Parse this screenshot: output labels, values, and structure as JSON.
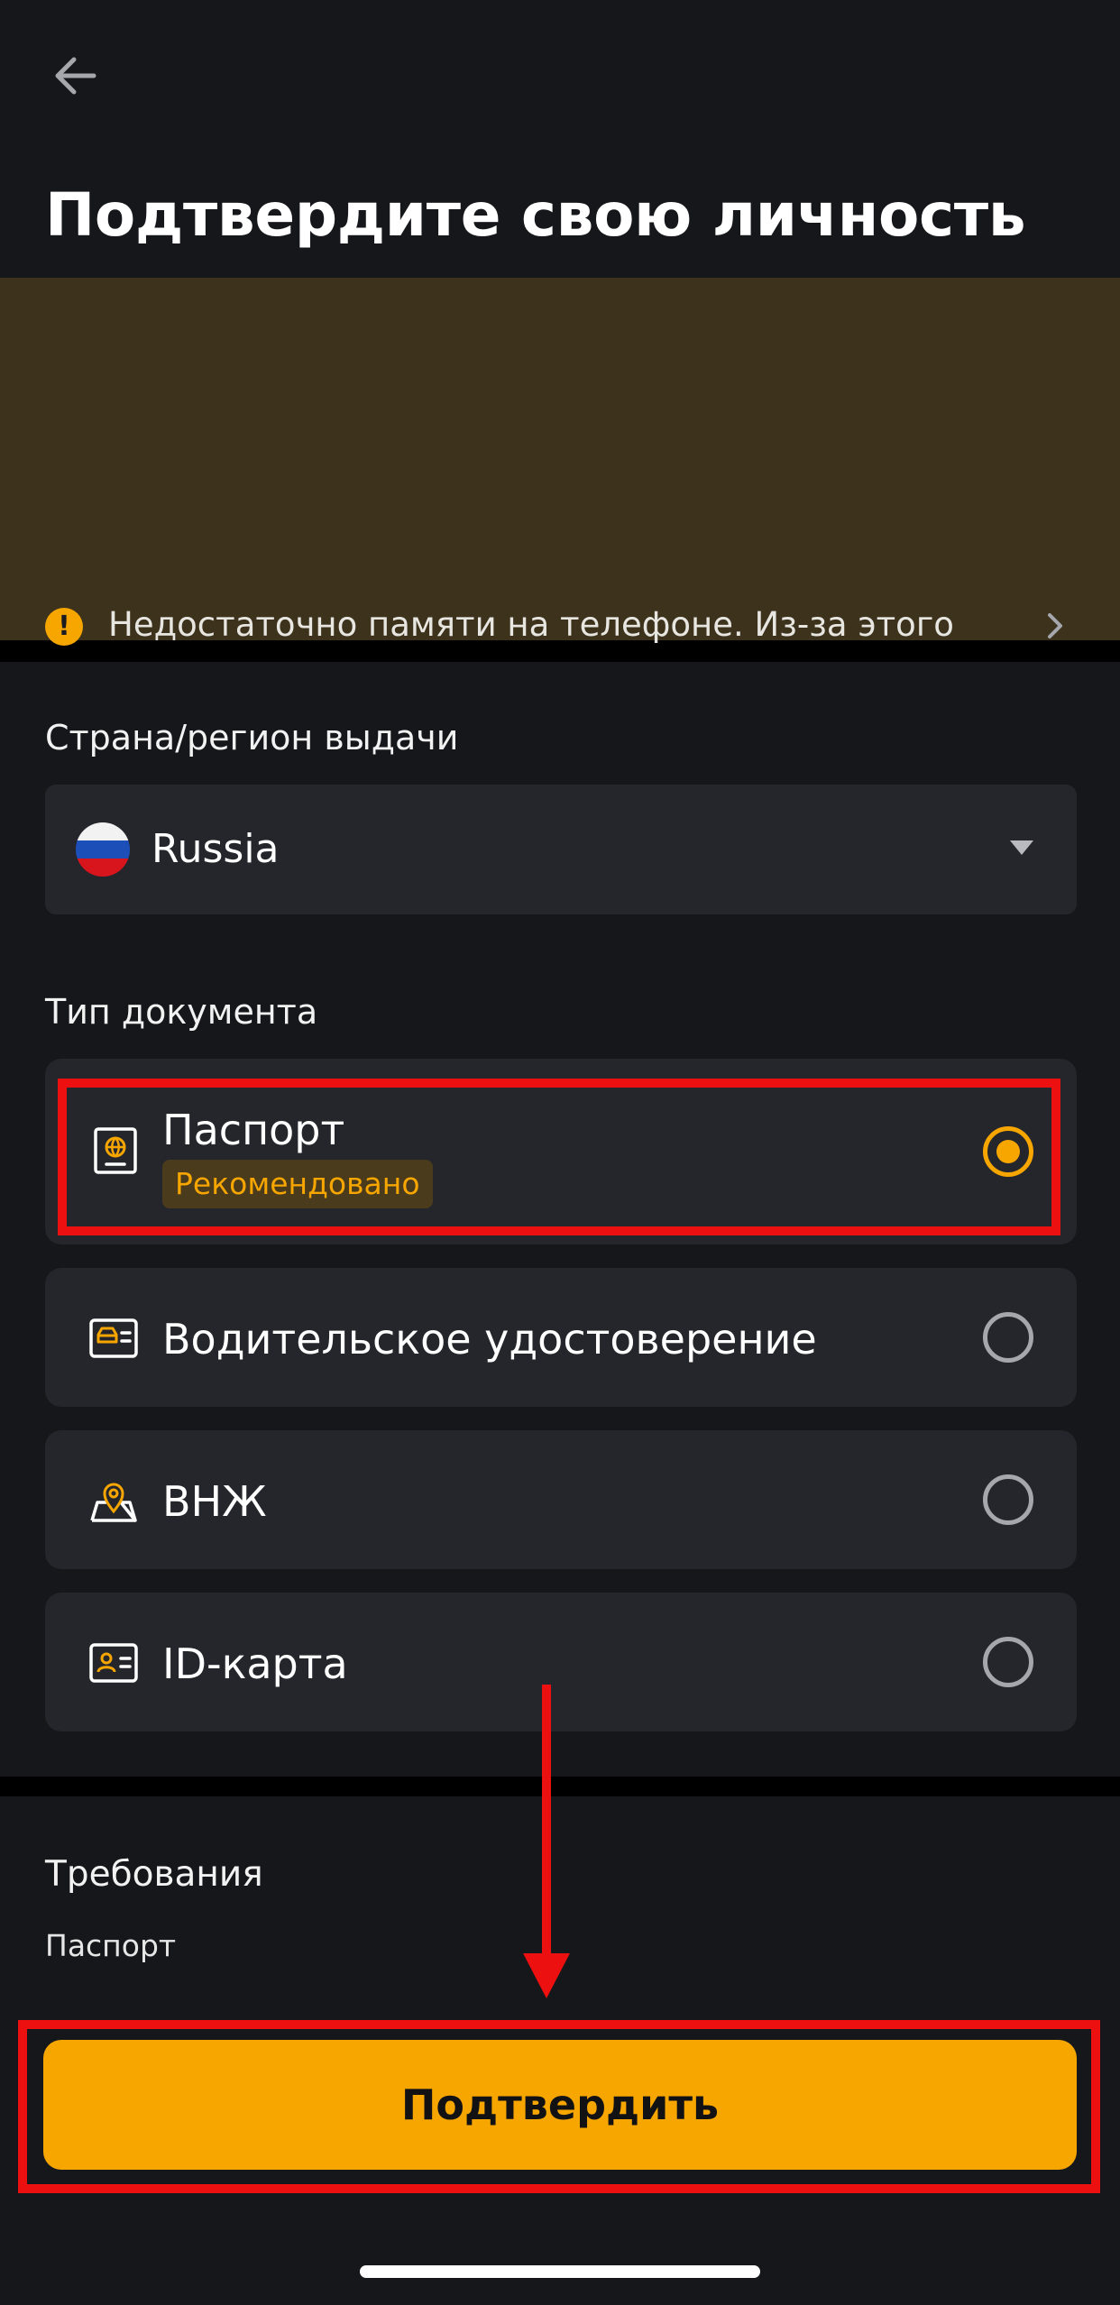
{
  "header": {
    "back_icon": "arrow-left-icon",
    "title": "Подтвердите свою личность"
  },
  "warning": {
    "icon": "exclamation-circle-icon",
    "text": "Недостаточно памяти на телефоне. Из-за этого процесс верификации может быть прерван. При возникновении проблем скопируйте ссылку и с помощью компьютера перейдите на веб-сайт Bybit, чтобы продолжить процесс верификации.",
    "chevron_icon": "chevron-right-icon"
  },
  "country": {
    "label": "Страна/регион выдачи",
    "selected": "Russia",
    "flag_icon": "russia-flag-icon"
  },
  "document_type": {
    "label": "Тип документа",
    "options": [
      {
        "label": "Паспорт",
        "badge": "Рекомендовано",
        "icon": "passport-icon",
        "selected": true
      },
      {
        "label": "Водительское удостоверение",
        "icon": "driver-license-icon",
        "selected": false
      },
      {
        "label": "ВНЖ",
        "icon": "residence-permit-icon",
        "selected": false
      },
      {
        "label": "ID-карта",
        "icon": "id-card-icon",
        "selected": false
      }
    ]
  },
  "requirements": {
    "title": "Требования",
    "value": "Паспорт"
  },
  "confirm_button": "Подтвердить",
  "colors": {
    "accent": "#f7a600",
    "background": "#16171b",
    "card": "#24262b",
    "warning_bg": "#3d321c",
    "annotation_red": "#ec1010"
  }
}
